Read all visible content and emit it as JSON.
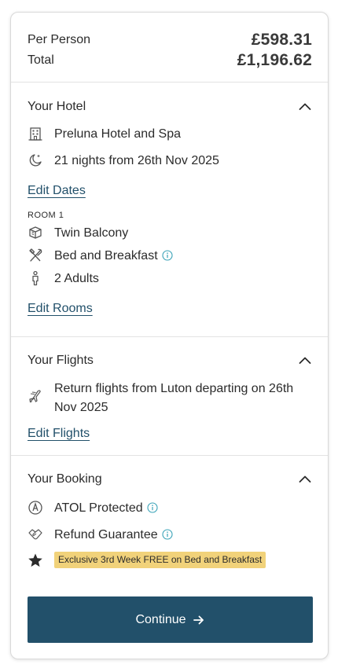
{
  "pricing": {
    "per_person_label": "Per Person",
    "per_person_value": "£598.31",
    "total_label": "Total",
    "total_value": "£1,196.62"
  },
  "hotel": {
    "title": "Your Hotel",
    "name": "Preluna Hotel and Spa",
    "nights": "21 nights from 26th Nov 2025",
    "edit_dates": "Edit Dates",
    "room_label": "ROOM 1",
    "room_type": "Twin Balcony",
    "board": "Bed and Breakfast",
    "guests": "2 Adults",
    "edit_rooms": "Edit Rooms"
  },
  "flights": {
    "title": "Your Flights",
    "description": "Return flights from Luton departing on 26th Nov 2025",
    "edit_flights": "Edit Flights"
  },
  "booking": {
    "title": "Your Booking",
    "atol": "ATOL Protected",
    "refund": "Refund Guarantee",
    "promo": "Exclusive 3rd Week FREE on Bed and Breakfast"
  },
  "cta": {
    "label": "Continue"
  },
  "colors": {
    "accent": "#22506a",
    "info_icon": "#3aa3b8",
    "promo_bg": "#f1d27a"
  }
}
